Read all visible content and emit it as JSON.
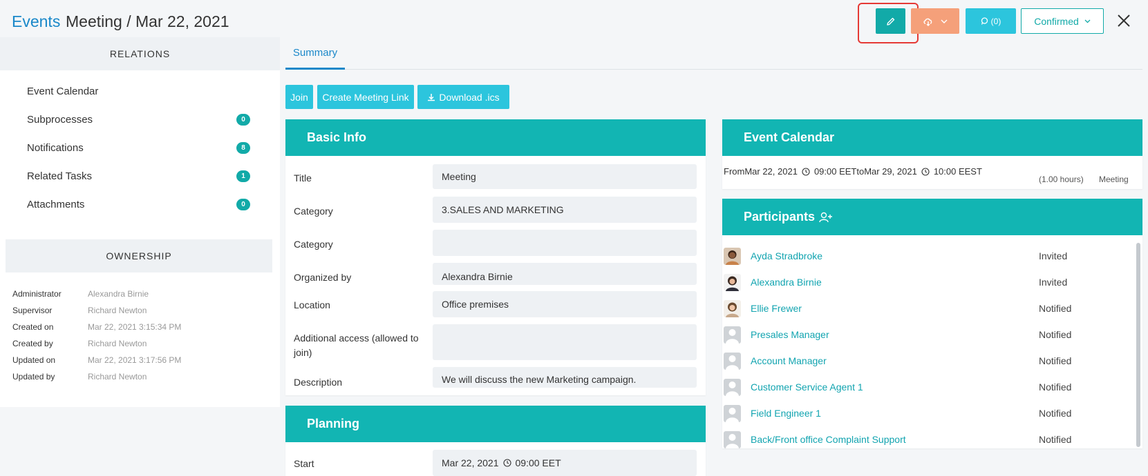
{
  "header": {
    "breadcrumb_root": "Events",
    "title": "Meeting / Mar 22, 2021",
    "comments_label": "(0)",
    "status_label": "Confirmed"
  },
  "tabs": [
    {
      "label": "Summary"
    }
  ],
  "actions": {
    "join": "Join",
    "create_link": "Create Meeting Link",
    "download": "Download .ics"
  },
  "relations": {
    "heading": "RELATIONS",
    "items": [
      {
        "label": "Event Calendar",
        "count": ""
      },
      {
        "label": "Subprocesses",
        "count": "0"
      },
      {
        "label": "Notifications",
        "count": "8"
      },
      {
        "label": "Related Tasks",
        "count": "1"
      },
      {
        "label": "Attachments",
        "count": "0"
      }
    ]
  },
  "ownership": {
    "heading": "OWNERSHIP",
    "rows": [
      {
        "key": "Administrator",
        "value": "Alexandra Birnie"
      },
      {
        "key": "Supervisor",
        "value": "Richard Newton"
      },
      {
        "key": "Created on",
        "value": "Mar 22, 2021 3:15:34 PM"
      },
      {
        "key": "Created by",
        "value": "Richard Newton"
      },
      {
        "key": "Updated on",
        "value": "Mar 22, 2021 3:17:56 PM"
      },
      {
        "key": "Updated by",
        "value": "Richard Newton"
      }
    ]
  },
  "basic_info": {
    "heading": "Basic Info",
    "fields": [
      {
        "label": "Title",
        "value": "Meeting"
      },
      {
        "label": "Category",
        "value": "3.SALES AND MARKETING"
      },
      {
        "label": "Category",
        "value": ""
      },
      {
        "label": "Organized by",
        "value": "Alexandra Birnie"
      },
      {
        "label": "Location",
        "value": "Office premises"
      },
      {
        "label": "Additional access (allowed to join)",
        "value": ""
      },
      {
        "label": "Description",
        "value": "We will discuss the new Marketing campaign."
      }
    ]
  },
  "planning": {
    "heading": "Planning",
    "start_label": "Start",
    "start_date": "Mar 22, 2021",
    "start_time": "09:00 EET"
  },
  "event_calendar": {
    "heading": "Event Calendar",
    "from": "FromMar 22, 2021",
    "from_time": "09:00 EETtoMar 29, 2021",
    "to_time": "10:00 EEST",
    "duration": "(1.00 hours)",
    "type": "Meeting"
  },
  "participants": {
    "heading": "Participants",
    "items": [
      {
        "name": "Ayda Stradbroke",
        "status": "Invited",
        "avatar": "photo"
      },
      {
        "name": "Alexandra Birnie",
        "status": "Invited",
        "avatar": "photo"
      },
      {
        "name": "Ellie Frewer",
        "status": "Notified",
        "avatar": "photo"
      },
      {
        "name": "Presales Manager",
        "status": "Notified",
        "avatar": "placeholder"
      },
      {
        "name": "Account Manager",
        "status": "Notified",
        "avatar": "placeholder"
      },
      {
        "name": "Customer Service Agent 1",
        "status": "Notified",
        "avatar": "placeholder"
      },
      {
        "name": "Field Engineer 1",
        "status": "Notified",
        "avatar": "placeholder"
      },
      {
        "name": "Back/Front office Complaint Support",
        "status": "Notified",
        "avatar": "placeholder"
      }
    ]
  },
  "colors": {
    "accent": "#12b5b3",
    "link": "#1a88c9",
    "orange": "#f5a07a",
    "cyan": "#2cc5dd"
  }
}
